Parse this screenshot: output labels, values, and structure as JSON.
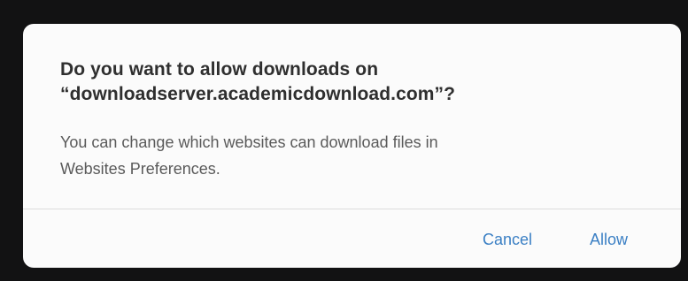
{
  "dialog": {
    "title_line1": "Do you want to allow downloads on",
    "title_line2": "“downloadserver.academicdownload.com”?",
    "message_line1": "You can change which websites can download files in",
    "message_line2": "Websites Preferences.",
    "cancel_label": "Cancel",
    "allow_label": "Allow"
  },
  "colors": {
    "backdrop": "#121213",
    "dialog_background": "#fbfbfb",
    "title_text": "#2f2f2f",
    "message_text": "#5a5a5a",
    "button_text": "#3a7fc4",
    "divider": "#dcdcdc"
  }
}
